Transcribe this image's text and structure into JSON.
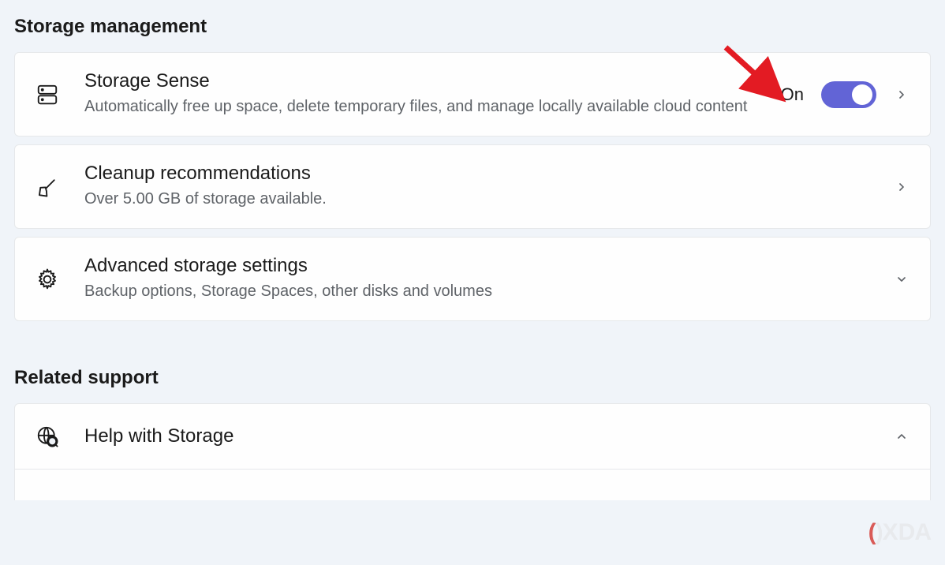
{
  "sections": {
    "storage_management": {
      "header": "Storage management"
    },
    "related_support": {
      "header": "Related support"
    }
  },
  "storage_sense": {
    "title": "Storage Sense",
    "description": "Automatically free up space, delete temporary files, and manage locally available cloud content",
    "toggle_state": "On",
    "toggle_on": true
  },
  "cleanup": {
    "title": "Cleanup recommendations",
    "description": "Over 5.00 GB of storage available."
  },
  "advanced": {
    "title": "Advanced storage settings",
    "description": "Backup options, Storage Spaces, other disks and volumes"
  },
  "help": {
    "title": "Help with Storage"
  },
  "watermark": {
    "text": "XDA"
  },
  "colors": {
    "accent": "#6264d6",
    "background": "#f0f4f9",
    "annotation_arrow": "#e31b23"
  }
}
